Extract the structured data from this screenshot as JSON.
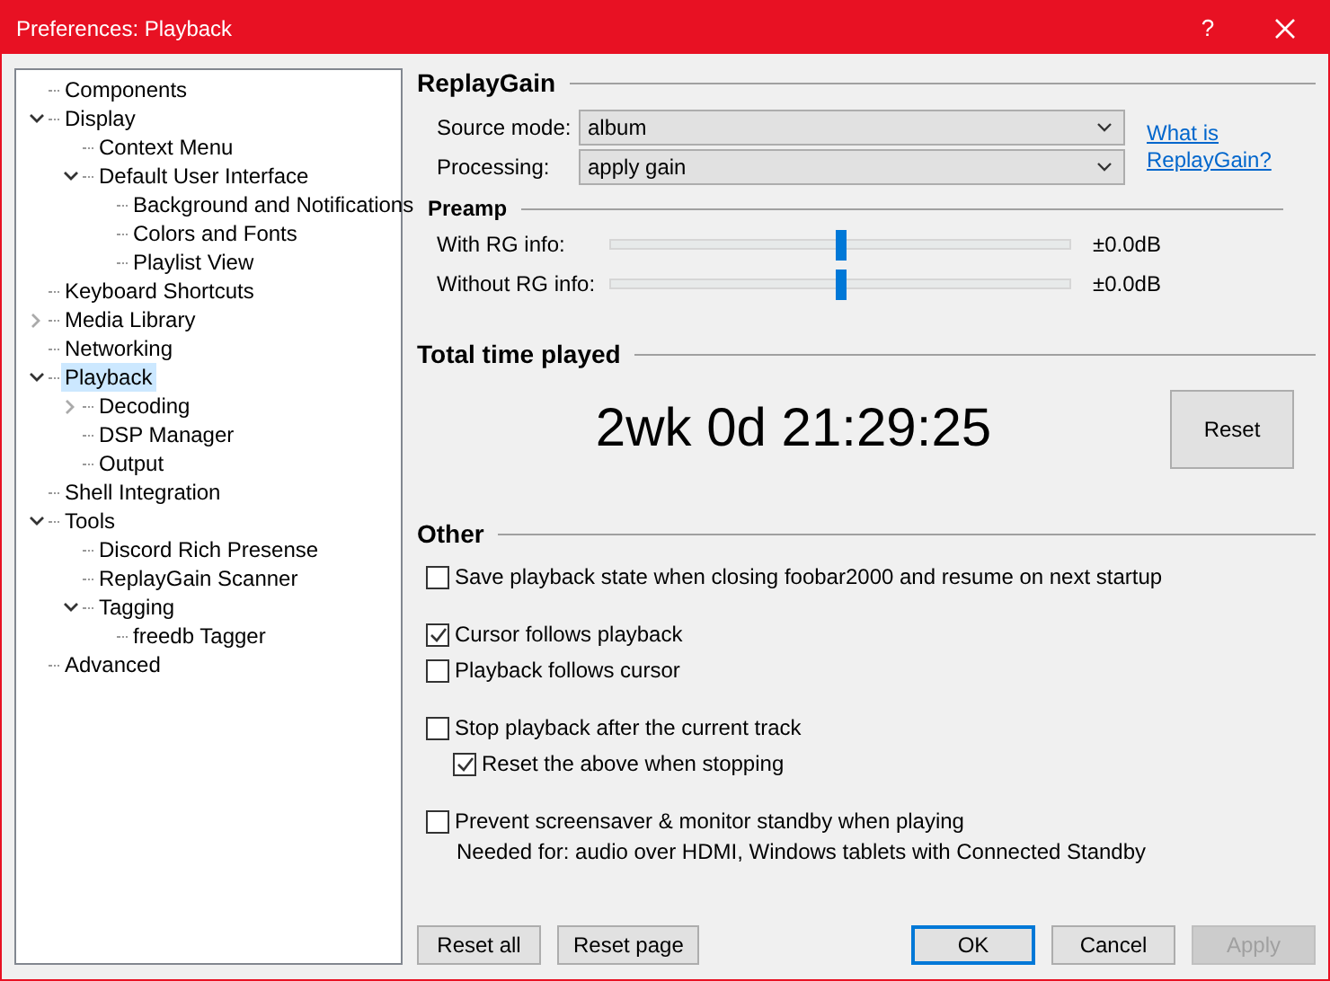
{
  "window": {
    "title": "Preferences: Playback",
    "help": "?"
  },
  "tree": [
    {
      "label": "Components",
      "selected": false
    },
    {
      "label": "Display",
      "expanded": true,
      "selected": false,
      "children": [
        {
          "label": "Context Menu",
          "selected": false
        },
        {
          "label": "Default User Interface",
          "expanded": true,
          "selected": false,
          "children": [
            {
              "label": "Background and Notifications",
              "selected": false
            },
            {
              "label": "Colors and Fonts",
              "selected": false
            },
            {
              "label": "Playlist View",
              "selected": false
            }
          ]
        }
      ]
    },
    {
      "label": "Keyboard Shortcuts",
      "selected": false
    },
    {
      "label": "Media Library",
      "expanded": false,
      "selected": false
    },
    {
      "label": "Networking",
      "selected": false
    },
    {
      "label": "Playback",
      "expanded": true,
      "selected": true,
      "children": [
        {
          "label": "Decoding",
          "expanded": false,
          "selected": false
        },
        {
          "label": "DSP Manager",
          "selected": false
        },
        {
          "label": "Output",
          "selected": false
        }
      ]
    },
    {
      "label": "Shell Integration",
      "selected": false
    },
    {
      "label": "Tools",
      "expanded": true,
      "selected": false,
      "children": [
        {
          "label": "Discord Rich Presense",
          "selected": false
        },
        {
          "label": "ReplayGain Scanner",
          "selected": false
        },
        {
          "label": "Tagging",
          "expanded": true,
          "selected": false,
          "children": [
            {
              "label": "freedb Tagger",
              "selected": false
            }
          ]
        }
      ]
    },
    {
      "label": "Advanced",
      "selected": false
    }
  ],
  "replaygain": {
    "title": "ReplayGain",
    "dropdowns": [
      {
        "label": "Source mode:",
        "value": "album"
      },
      {
        "label": "Processing:",
        "value": "apply gain"
      }
    ],
    "link": "What is ReplayGain?",
    "preamp": {
      "title": "Preamp",
      "sliders": [
        {
          "label": "With RG info:",
          "level": 0.5,
          "reading": "±0.0dB"
        },
        {
          "label": "Without RG info:",
          "level": 0.5,
          "reading": "±0.0dB"
        }
      ]
    }
  },
  "total_time": {
    "title": "Total time played",
    "value": "2wk 0d 21:29:25",
    "button": "Reset"
  },
  "other": {
    "title": "Other",
    "groups": [
      [
        {
          "kind": "checkbox",
          "label": "Save playback state when closing foobar2000 and resume on next startup",
          "checked": false
        }
      ],
      [
        {
          "kind": "checkbox",
          "label": "Cursor follows playback",
          "checked": true
        },
        {
          "kind": "checkbox",
          "label": "Playback follows cursor",
          "checked": false
        }
      ],
      [
        {
          "kind": "checkbox",
          "label": "Stop playback after the current track",
          "checked": false
        },
        {
          "kind": "subcheckbox",
          "label": "Reset the above when stopping",
          "checked": true
        }
      ],
      [
        {
          "kind": "checkbox",
          "label": "Prevent screensaver & monitor standby when playing",
          "checked": false
        },
        {
          "kind": "note",
          "label": "Needed for: audio over HDMI, Windows tablets with Connected Standby"
        }
      ]
    ]
  },
  "left_buttons": [
    {
      "label": "Reset all",
      "default": false,
      "disabled": false
    },
    {
      "label": "Reset page",
      "default": false,
      "disabled": false
    }
  ],
  "right_buttons": [
    {
      "label": "OK",
      "default": true,
      "disabled": false
    },
    {
      "label": "Cancel",
      "default": false,
      "disabled": false
    },
    {
      "label": "Apply",
      "default": false,
      "disabled": true
    }
  ]
}
